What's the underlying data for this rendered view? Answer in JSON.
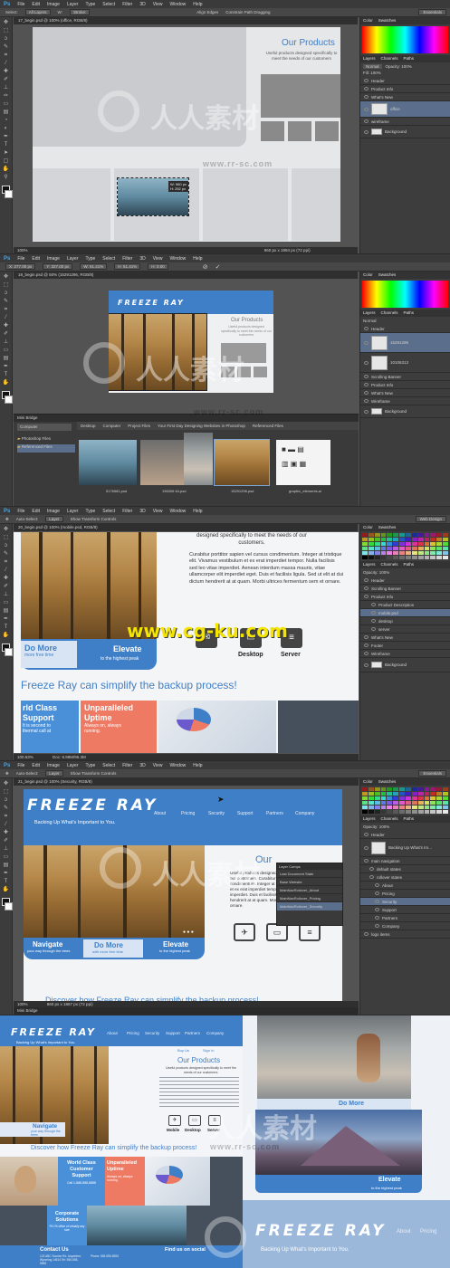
{
  "menu": {
    "ps": "Ps",
    "items": [
      "File",
      "Edit",
      "Image",
      "Layer",
      "Type",
      "Select",
      "Filter",
      "3D",
      "View",
      "Window",
      "Help"
    ]
  },
  "frame1": {
    "options": [
      "Select:",
      "All Layers",
      "W:",
      "Stroke:"
    ],
    "align": "Align Edges",
    "constrain": "Constrain Path Dragging",
    "workspace": "Essentials",
    "doc_tab": "17_begin.psd @ 100% (office, RGB/8)",
    "heading": "Our Products",
    "para": "Useful products designed specifically to meet the needs of our customers",
    "readout_w": "W: 960 px",
    "readout_h": "H: 252 px",
    "status": "100%",
    "status_doc": "960 px x 1994 px (72 ppi)",
    "tab_labels": [
      "Color",
      "Swatches"
    ],
    "layer_tabs": [
      "Layers",
      "Channels",
      "Paths"
    ],
    "blend": "Normal",
    "opacity": "Opacity: 100%",
    "fill": "Fill: 100%",
    "layers": [
      "Header",
      "Product Info",
      "What's New",
      "office",
      "wireframe",
      "Background"
    ]
  },
  "frame2": {
    "options": [
      "X: 277.00 px",
      "Y: 327.00 px",
      "W: 61.41%",
      "H: 51.41%",
      "H: 0.00"
    ],
    "doc_tab": "18_begin.psd @ 50% (15291296, RGB/8)",
    "brand": "FREEZE RAY",
    "heading": "Our Products",
    "para": "Useful products designed specifically to meet the needs of our customers",
    "bridge_label": "Mini Bridge",
    "breadcrumb": [
      "Desktop",
      "Computer",
      "Project Files",
      "Your First Day Designing Websites in Photoshop",
      "Referenced Files"
    ],
    "folders": [
      "Photoshop Files",
      "Referenced Files"
    ],
    "computer": "Computer",
    "thumbs": [
      "5176581.psd",
      "196306 64.psd",
      "15291296.psd",
      "graphic_elements.ai"
    ],
    "status": "50%",
    "status_doc": "960 px x 1994 px (72 ppi)",
    "layers": [
      "Header",
      "15291296",
      "10106313",
      "Scrolling Banner",
      "Product Info",
      "What's New",
      "Wireframe",
      "Background"
    ]
  },
  "frame3": {
    "options": [
      "Auto-Select:",
      "Layer",
      "Show Transform Controls"
    ],
    "workspace": "Web Design",
    "doc_tab": "20_begin.psd @ 100% (mobile.psd, RGB/8)",
    "para_top": "designed specifically to meet the needs of our customers.",
    "para": "Curabitur porttitor sapien vel cursus condimentum. Integer at tristique elit. Vivamus vestibulum et ex erat imperdiet tempor. Nulla facilisis sed leo vitae imperdiet. Aenean interdum massa mauris, vitae ullamcorper elit imperdiet eget. Duis et facilisis ligula. Sed ut elit at dui dictum hendrerit at at quam. Morbi ultrices fermentum sem et ornare.",
    "do_more": "Do More",
    "do_more_sub": "more free time",
    "elevate": "Elevate",
    "elevate_sub": "to the highest peak",
    "desktop": "Desktop",
    "server": "Server",
    "headline": "Freeze Ray can simplify the backup process!",
    "world_class": "rld Class Support",
    "world_sub": "It is second to",
    "world_sub2": "thermal call at",
    "unparalleled": "Unparalleled Uptime",
    "uptime_sub": "Always on, always",
    "uptime_sub2": "running.",
    "status": "100.63%",
    "status_doc": "Doc: 6.98M/96.3M",
    "layers": [
      "Header",
      "Scrolling Banner",
      "Product Info",
      "Product Description",
      "mobile.psd",
      "desktop",
      "server",
      "What's New",
      "Footer",
      "Wireframe",
      "Background"
    ]
  },
  "frame4": {
    "options": [
      "Auto-Select:",
      "Layer",
      "Show Transform Controls"
    ],
    "workspace": "Essentials",
    "doc_tab": "21_begin.psd @ 100% (Security, RGB/8)",
    "brand": "FREEZE RAY",
    "tagline": "Backing Up What's Important to You.",
    "nav": [
      "About",
      "Pricing",
      "Security",
      "Support",
      "Partners",
      "Company"
    ],
    "our_heading": "Our",
    "para": "Useful products designed specifically to meet the needs of our customers. Curabitur porttitor sapien vel cursus condimentum. Integer at tristique elit. Vivamus vestibulum et ex erat imperdiet tempor. Nulla facilisis sed leo vitae imperdiet. Duis et facilisis ligula. Sed ut elit at dui dictum hendrerit at at quam. Morbi ultrices fermentum sem et ornare.",
    "navigate": "Navigate",
    "navigate_sub": "your way through the trees",
    "do_more": "Do More",
    "do_more_sub": "with more free time",
    "elevate": "Elevate",
    "elevate_sub": "to the highest peak",
    "discover": "Discover how Freeze Ray can simplify the backup process!",
    "comps_title": "Layer Comps",
    "comps": [
      "Last Document State",
      "Base Website",
      "MainNavRollover_About",
      "MainNavRollover_Pricing",
      "MainNavRollover_Security"
    ],
    "status": "100%",
    "status_doc": "960 px x 1867 px (72 ppi)",
    "bridge_label": "Mini Bridge",
    "layers": [
      "Header",
      "Backing Up What's Im...",
      "main navigation",
      "default states",
      "rollover states",
      "About",
      "Pricing",
      "Security",
      "Support",
      "Partners",
      "Company",
      "logo items"
    ]
  },
  "frame5": {
    "brand": "FREEZE RAY",
    "tagline": "Backing Up What's Important to You.",
    "nav": [
      "About",
      "Pricing",
      "Security",
      "Support",
      "Partners",
      "Company"
    ],
    "buy": "Buy Us",
    "sign_in": "Sign In",
    "heading": "Our Products",
    "para": "Useful products designed specifically to meet the needs of our customers.",
    "mobile": "Mobile",
    "desktop": "Desktop",
    "server": "Server",
    "navigate": "Navigate",
    "navigate_sub": "your way through the trees",
    "discover": "Discover how Freeze Ray can simplify the backup process!",
    "world_class": "World Class Customer Support",
    "world_sub": "Call 1-888-888-8888",
    "unparalleled": "Unparalleled Uptime",
    "uptime_sub": "Always on, always running.",
    "corporate": "Corporate Solutions",
    "corporate_sub": "Fit 1% office of virtually any size",
    "contact": "Contact Us",
    "address": "123 ABC Sunrise Rd. Anywhere, Wyoming 14614 Tel: 555-555-5555",
    "phone": "Phone: 555-555-5555",
    "find": "Find us on social",
    "do_more": "Do More",
    "do_more_sub": "with more free time",
    "elevate": "Elevate",
    "elevate_sub": "to the highest peak",
    "brand_big": "FREEZE RAY",
    "tagline_big": "Backing Up What's Important to You.",
    "about": "About",
    "pricing": "Pricing"
  },
  "watermarks": {
    "cn": "人人素材",
    "url": "www.rr-sc.com",
    "cgku": "www.cg-ku.com"
  }
}
